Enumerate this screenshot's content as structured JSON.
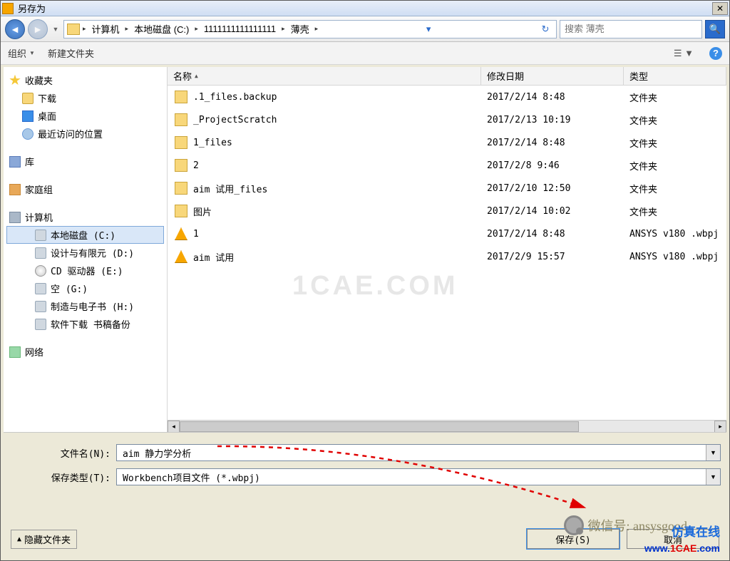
{
  "dialog": {
    "title": "另存为"
  },
  "path": {
    "segments": [
      "计算机",
      "本地磁盘 (C:)",
      "1111111111111111",
      "薄壳"
    ]
  },
  "search": {
    "placeholder": "搜索 薄壳"
  },
  "toolbar": {
    "organize": "组织",
    "newfolder": "新建文件夹"
  },
  "columns": {
    "name": "名称",
    "date": "修改日期",
    "type": "类型"
  },
  "tree": {
    "favorites": "收藏夹",
    "downloads": "下载",
    "desktop": "桌面",
    "recent": "最近访问的位置",
    "libraries": "库",
    "homegroup": "家庭组",
    "computer": "计算机",
    "drive_c": "本地磁盘 (C:)",
    "drive_d": "设计与有限元 (D:)",
    "drive_e": "CD 驱动器 (E:)",
    "drive_g": "空 (G:)",
    "drive_h": "制造与电子书 (H:)",
    "drive_i": "软件下载 书稿备份",
    "network": "网络"
  },
  "files": [
    {
      "icon": "folder",
      "name": ".1_files.backup",
      "date": "2017/2/14 8:48",
      "type": "文件夹"
    },
    {
      "icon": "folder",
      "name": "_ProjectScratch",
      "date": "2017/2/13 10:19",
      "type": "文件夹"
    },
    {
      "icon": "folder",
      "name": "1_files",
      "date": "2017/2/14 8:48",
      "type": "文件夹"
    },
    {
      "icon": "folder",
      "name": "2",
      "date": "2017/2/8 9:46",
      "type": "文件夹"
    },
    {
      "icon": "folder",
      "name": "aim 试用_files",
      "date": "2017/2/10 12:50",
      "type": "文件夹"
    },
    {
      "icon": "folder",
      "name": "图片",
      "date": "2017/2/14 10:02",
      "type": "文件夹"
    },
    {
      "icon": "ansys",
      "name": "1",
      "date": "2017/2/14 8:48",
      "type": "ANSYS v180 .wbpj"
    },
    {
      "icon": "ansys",
      "name": "aim 试用",
      "date": "2017/2/9 15:57",
      "type": "ANSYS v180 .wbpj"
    }
  ],
  "fields": {
    "filename_label": "文件名(N):",
    "filename_value": "aim 静力学分析",
    "filetype_label": "保存类型(T):",
    "filetype_value": "Workbench项目文件 (*.wbpj)"
  },
  "buttons": {
    "hide_folders": "隐藏文件夹",
    "save": "保存(S)",
    "cancel": "取消"
  },
  "overlay": {
    "watermark_center": "1CAE.COM",
    "wechat": "微信号: ansysgood",
    "brand_cn": "仿真在线",
    "brand_url_pre": "www.",
    "brand_url_mid": "1CAE",
    "brand_url_suf": ".com"
  }
}
